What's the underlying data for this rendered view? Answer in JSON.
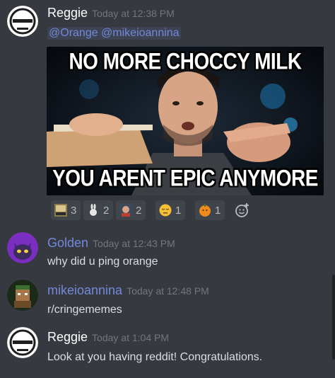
{
  "messages": [
    {
      "username": "Reggie",
      "username_color": "#ffffff",
      "timestamp": "Today at 12:38 PM",
      "mentions": "@Orange @mikeioannina",
      "image": {
        "top_text": "NO MORE CHOCCY MILK",
        "bottom_text": "YOU ARENT EPIC ANYMORE"
      },
      "reactions": [
        {
          "emoji": "fortnite-emote",
          "count": "3"
        },
        {
          "emoji": "rabbit-emote",
          "count": "2"
        },
        {
          "emoji": "old-man-emote",
          "count": "2"
        },
        {
          "emoji": "sleepy-face-emoji",
          "count": "1"
        },
        {
          "emoji": "orange-face-emote",
          "count": "1"
        }
      ]
    },
    {
      "username": "Golden",
      "username_color": "#7289da",
      "timestamp": "Today at 12:43 PM",
      "text": "why did u ping orange"
    },
    {
      "username": "mikeioannina",
      "username_color": "#7289da",
      "timestamp": "Today at 12:48 PM",
      "text": "r/cringememes"
    },
    {
      "username": "Reggie",
      "username_color": "#ffffff",
      "timestamp": "Today at 1:04 PM",
      "text": "Look at you having reddit! Congratulations."
    }
  ],
  "colors": {
    "background": "#36393f",
    "mention": "#7289da",
    "timestamp": "#72767d",
    "reaction_bg": "#40444b"
  }
}
